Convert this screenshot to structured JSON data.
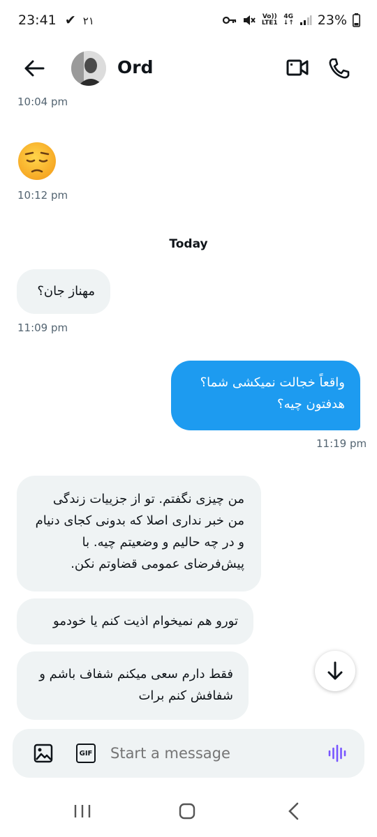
{
  "status_bar": {
    "time": "23:41",
    "notif": "۲۱",
    "battery": "23%",
    "network_top": "Vo))",
    "network_bottom": "LTE1",
    "gen": "4G"
  },
  "header": {
    "contact_name": "Ord"
  },
  "messages": [
    {
      "type": "timestamp",
      "text": "10:04 pm"
    },
    {
      "type": "emoji",
      "text": "😔"
    },
    {
      "type": "timestamp",
      "text": "10:12 pm"
    },
    {
      "type": "divider",
      "text": "Today"
    },
    {
      "type": "in",
      "text": "مهناز جان؟"
    },
    {
      "type": "timestamp",
      "text": "11:09 pm"
    },
    {
      "type": "out",
      "text": "واقعاً خجالت نمیکشی شما؟ هدفتون چیه؟"
    },
    {
      "type": "timestamp",
      "text": "11:19 pm"
    },
    {
      "type": "in",
      "text": "من چیزی نگفتم. تو از جزییات زندگی من خبر نداری اصلا که بدونی کجای دنیام و در چه حالیم و وضعیتم چیه. با پیش‌فرضای عمومی قضاوتم نکن."
    },
    {
      "type": "in",
      "text": "تورو هم نمیخوام اذیت کنم یا خودمو"
    },
    {
      "type": "in",
      "text": "فقط دارم سعی میکنم شفاف باشم و شفافش کنم برات"
    }
  ],
  "composer": {
    "placeholder": "Start a message",
    "gif_label": "GIF"
  },
  "colors": {
    "accent": "#1d9bf0",
    "incoming_bg": "#eff3f4",
    "muted_text": "#536471",
    "voice_icon": "#7856ff"
  }
}
